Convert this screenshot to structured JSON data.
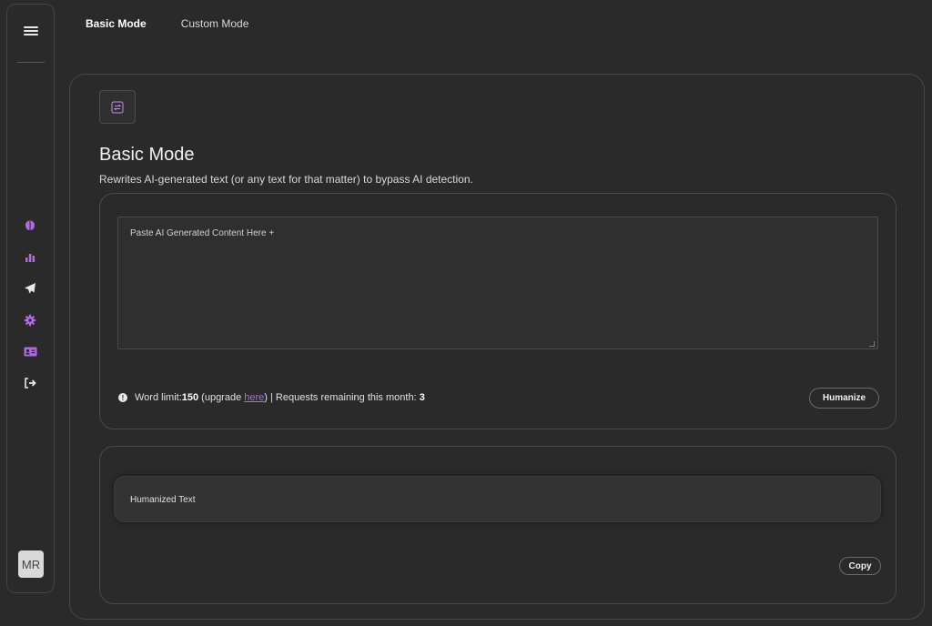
{
  "sidebar": {
    "menu_icon": "hamburger-menu-icon",
    "accent_color": "#b06be0",
    "items": [
      {
        "icon": "brain-icon"
      },
      {
        "icon": "bar-chart-icon"
      },
      {
        "icon": "paper-plane-icon"
      },
      {
        "icon": "gear-icon"
      },
      {
        "icon": "id-card-icon"
      },
      {
        "icon": "logout-icon"
      }
    ],
    "avatar_initials": "MR"
  },
  "topnav": {
    "tabs": [
      {
        "label": "Basic Mode",
        "active": true
      },
      {
        "label": "Custom Mode",
        "active": false
      }
    ]
  },
  "main": {
    "mode_icon": "swap-arrows-icon",
    "title": "Basic Mode",
    "description": "Rewrites AI-generated text (or any text for that matter) to bypass AI detection.",
    "input": {
      "placeholder": "Paste AI Generated Content Here +",
      "value": ""
    },
    "limits": {
      "prefix": "Word limit: ",
      "word_limit": "150",
      "upgrade_open": " (upgrade ",
      "upgrade_link": "here",
      "upgrade_close": ") | Requests remaining this month: ",
      "requests_remaining": "3"
    },
    "humanize_label": "Humanize",
    "output": {
      "placeholder": "Humanized Text"
    },
    "copy_label": "Copy"
  }
}
